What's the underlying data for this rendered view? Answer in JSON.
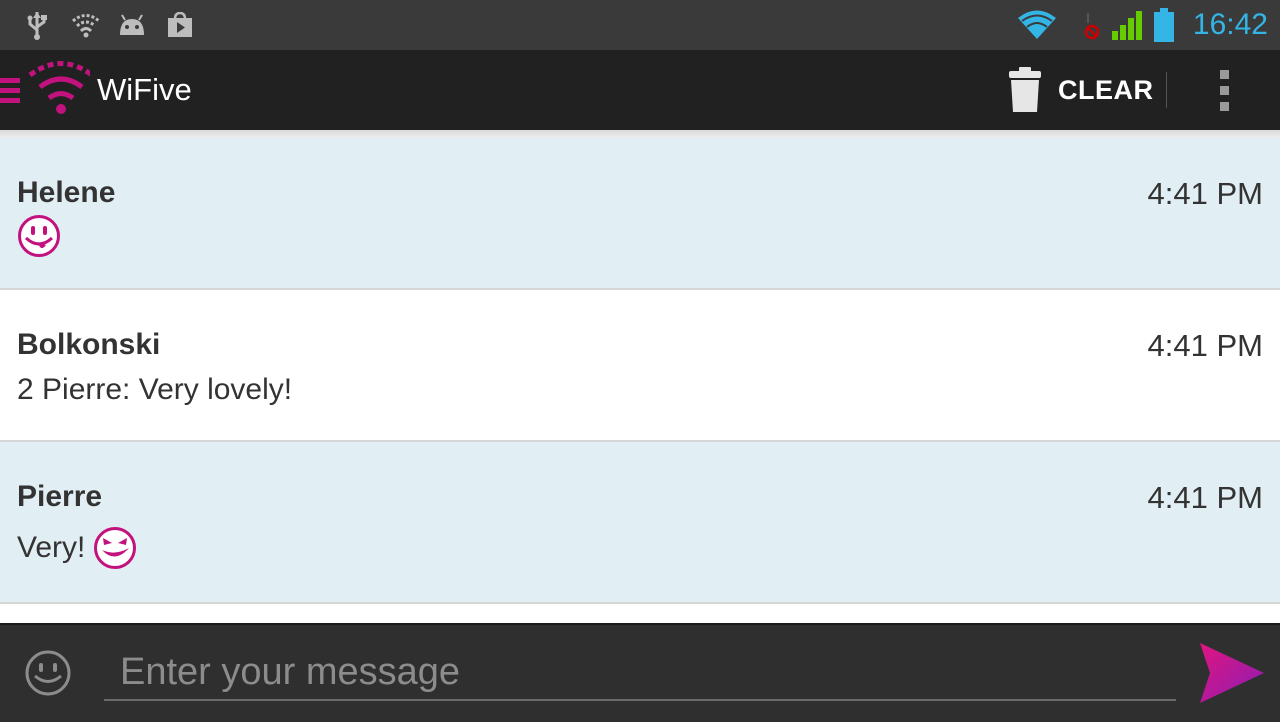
{
  "status_bar": {
    "time": "16:42",
    "left_icons": [
      "usb-icon",
      "wifi-status-icon",
      "android-icon",
      "play-store-icon"
    ],
    "right_icons": [
      "wifi-icon",
      "signal-icon",
      "battery-icon"
    ],
    "accent_color": "#33b5e5"
  },
  "action_bar": {
    "title": "WiFive",
    "clear_label": "CLEAR",
    "brand_color": "#c2127e"
  },
  "messages": [
    {
      "sender": "Helene",
      "time": "4:41 PM",
      "text": "",
      "emoji": "smiley-tongue-icon"
    },
    {
      "sender": "Bolkonski",
      "time": "4:41 PM",
      "text": "2 Pierre: Very lovely!",
      "emoji": ""
    },
    {
      "sender": "Pierre",
      "time": "4:41 PM",
      "text": "Very!",
      "emoji": "devil-grin-icon"
    }
  ],
  "input": {
    "placeholder": "Enter your message",
    "value": ""
  }
}
